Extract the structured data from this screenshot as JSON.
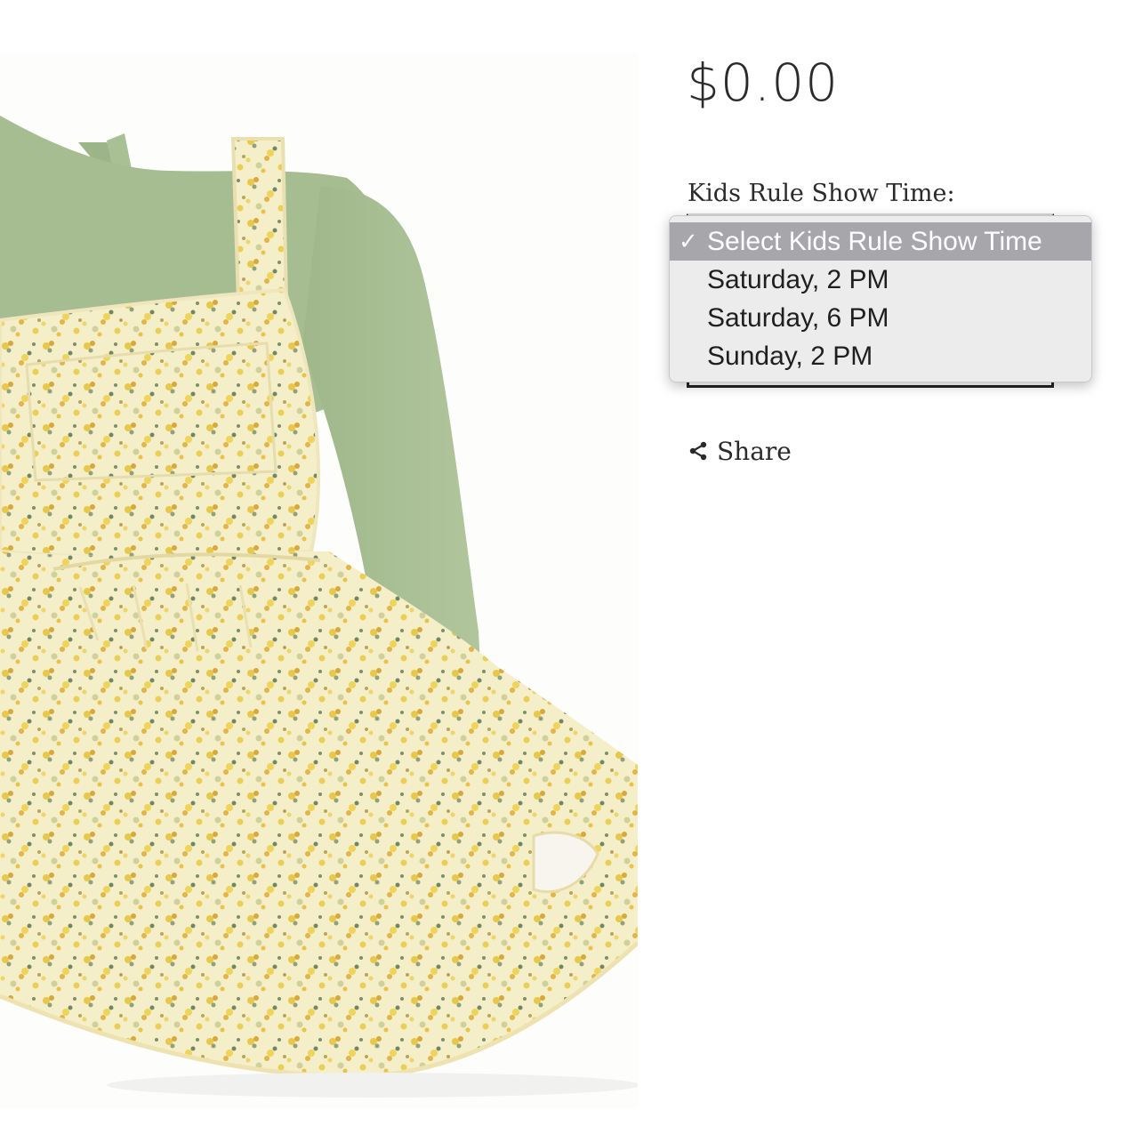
{
  "product": {
    "price": "$0.00",
    "image_alt": "Floral pinafore dress with green long-sleeve top"
  },
  "options": {
    "label": "Kids Rule Show Time:",
    "selected": "Select Kids Rule Show Time",
    "items": [
      {
        "label": "Select Kids Rule Show Time",
        "selected": true
      },
      {
        "label": "Saturday, 2 PM",
        "selected": false
      },
      {
        "label": "Saturday, 6 PM",
        "selected": false
      },
      {
        "label": "Sunday, 2 PM",
        "selected": false
      }
    ]
  },
  "share": {
    "label": "Share",
    "icon": "share-icon"
  },
  "colors": {
    "text": "#2b2b2b",
    "dropdown_bg": "#ececec",
    "selected_bg": "#a7a6ab",
    "shirt_green": "#a7bd92",
    "dress_cream": "#f3ecc6",
    "flower_yellow": "#e7c64a"
  }
}
